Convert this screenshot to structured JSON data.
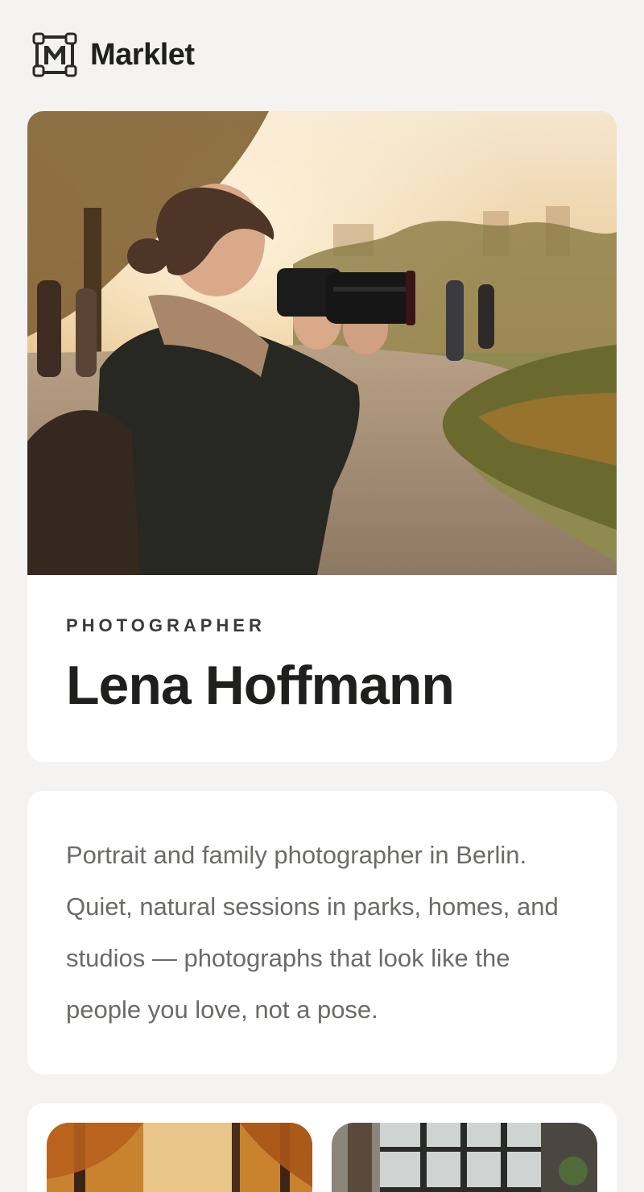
{
  "brand": {
    "name": "Marklet",
    "logo_icon": "marklet-logo-icon"
  },
  "profile": {
    "role": "PHOTOGRAPHER",
    "name": "Lena Hoffmann",
    "photo_icon": "photographer-portrait-photo"
  },
  "bio": {
    "text": "Portrait and family photographer in Berlin. Quiet, natural sessions in parks, homes, and studios — photographs that look like the people you love, not a pose."
  },
  "gallery": {
    "items": [
      {
        "icon": "autumn-forest-photo"
      },
      {
        "icon": "window-interior-photo"
      }
    ]
  },
  "colors": {
    "background": "#f4f3f1",
    "card": "#ffffff",
    "text_primary": "#1f1f1d",
    "text_secondary": "#6b6b67"
  }
}
